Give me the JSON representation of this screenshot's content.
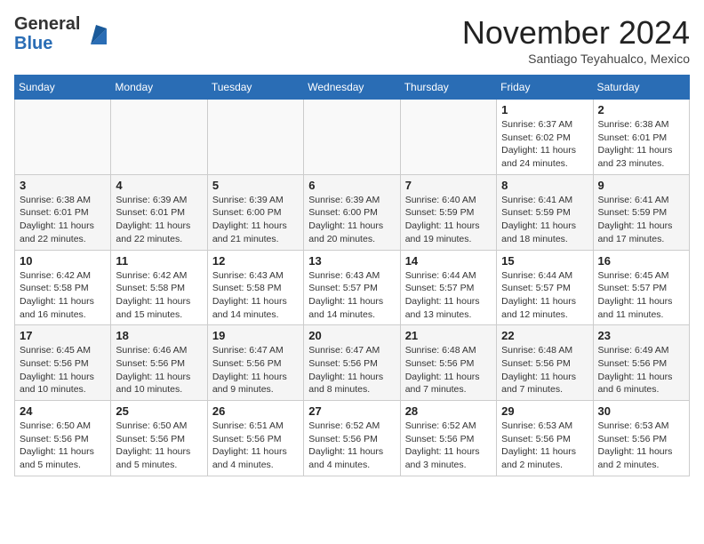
{
  "header": {
    "logo_general": "General",
    "logo_blue": "Blue",
    "month_year": "November 2024",
    "location": "Santiago Teyahualco, Mexico"
  },
  "weekdays": [
    "Sunday",
    "Monday",
    "Tuesday",
    "Wednesday",
    "Thursday",
    "Friday",
    "Saturday"
  ],
  "weeks": [
    [
      {
        "day": "",
        "info": ""
      },
      {
        "day": "",
        "info": ""
      },
      {
        "day": "",
        "info": ""
      },
      {
        "day": "",
        "info": ""
      },
      {
        "day": "",
        "info": ""
      },
      {
        "day": "1",
        "info": "Sunrise: 6:37 AM\nSunset: 6:02 PM\nDaylight: 11 hours and 24 minutes."
      },
      {
        "day": "2",
        "info": "Sunrise: 6:38 AM\nSunset: 6:01 PM\nDaylight: 11 hours and 23 minutes."
      }
    ],
    [
      {
        "day": "3",
        "info": "Sunrise: 6:38 AM\nSunset: 6:01 PM\nDaylight: 11 hours and 22 minutes."
      },
      {
        "day": "4",
        "info": "Sunrise: 6:39 AM\nSunset: 6:01 PM\nDaylight: 11 hours and 22 minutes."
      },
      {
        "day": "5",
        "info": "Sunrise: 6:39 AM\nSunset: 6:00 PM\nDaylight: 11 hours and 21 minutes."
      },
      {
        "day": "6",
        "info": "Sunrise: 6:39 AM\nSunset: 6:00 PM\nDaylight: 11 hours and 20 minutes."
      },
      {
        "day": "7",
        "info": "Sunrise: 6:40 AM\nSunset: 5:59 PM\nDaylight: 11 hours and 19 minutes."
      },
      {
        "day": "8",
        "info": "Sunrise: 6:41 AM\nSunset: 5:59 PM\nDaylight: 11 hours and 18 minutes."
      },
      {
        "day": "9",
        "info": "Sunrise: 6:41 AM\nSunset: 5:59 PM\nDaylight: 11 hours and 17 minutes."
      }
    ],
    [
      {
        "day": "10",
        "info": "Sunrise: 6:42 AM\nSunset: 5:58 PM\nDaylight: 11 hours and 16 minutes."
      },
      {
        "day": "11",
        "info": "Sunrise: 6:42 AM\nSunset: 5:58 PM\nDaylight: 11 hours and 15 minutes."
      },
      {
        "day": "12",
        "info": "Sunrise: 6:43 AM\nSunset: 5:58 PM\nDaylight: 11 hours and 14 minutes."
      },
      {
        "day": "13",
        "info": "Sunrise: 6:43 AM\nSunset: 5:57 PM\nDaylight: 11 hours and 14 minutes."
      },
      {
        "day": "14",
        "info": "Sunrise: 6:44 AM\nSunset: 5:57 PM\nDaylight: 11 hours and 13 minutes."
      },
      {
        "day": "15",
        "info": "Sunrise: 6:44 AM\nSunset: 5:57 PM\nDaylight: 11 hours and 12 minutes."
      },
      {
        "day": "16",
        "info": "Sunrise: 6:45 AM\nSunset: 5:57 PM\nDaylight: 11 hours and 11 minutes."
      }
    ],
    [
      {
        "day": "17",
        "info": "Sunrise: 6:45 AM\nSunset: 5:56 PM\nDaylight: 11 hours and 10 minutes."
      },
      {
        "day": "18",
        "info": "Sunrise: 6:46 AM\nSunset: 5:56 PM\nDaylight: 11 hours and 10 minutes."
      },
      {
        "day": "19",
        "info": "Sunrise: 6:47 AM\nSunset: 5:56 PM\nDaylight: 11 hours and 9 minutes."
      },
      {
        "day": "20",
        "info": "Sunrise: 6:47 AM\nSunset: 5:56 PM\nDaylight: 11 hours and 8 minutes."
      },
      {
        "day": "21",
        "info": "Sunrise: 6:48 AM\nSunset: 5:56 PM\nDaylight: 11 hours and 7 minutes."
      },
      {
        "day": "22",
        "info": "Sunrise: 6:48 AM\nSunset: 5:56 PM\nDaylight: 11 hours and 7 minutes."
      },
      {
        "day": "23",
        "info": "Sunrise: 6:49 AM\nSunset: 5:56 PM\nDaylight: 11 hours and 6 minutes."
      }
    ],
    [
      {
        "day": "24",
        "info": "Sunrise: 6:50 AM\nSunset: 5:56 PM\nDaylight: 11 hours and 5 minutes."
      },
      {
        "day": "25",
        "info": "Sunrise: 6:50 AM\nSunset: 5:56 PM\nDaylight: 11 hours and 5 minutes."
      },
      {
        "day": "26",
        "info": "Sunrise: 6:51 AM\nSunset: 5:56 PM\nDaylight: 11 hours and 4 minutes."
      },
      {
        "day": "27",
        "info": "Sunrise: 6:52 AM\nSunset: 5:56 PM\nDaylight: 11 hours and 4 minutes."
      },
      {
        "day": "28",
        "info": "Sunrise: 6:52 AM\nSunset: 5:56 PM\nDaylight: 11 hours and 3 minutes."
      },
      {
        "day": "29",
        "info": "Sunrise: 6:53 AM\nSunset: 5:56 PM\nDaylight: 11 hours and 2 minutes."
      },
      {
        "day": "30",
        "info": "Sunrise: 6:53 AM\nSunset: 5:56 PM\nDaylight: 11 hours and 2 minutes."
      }
    ]
  ]
}
